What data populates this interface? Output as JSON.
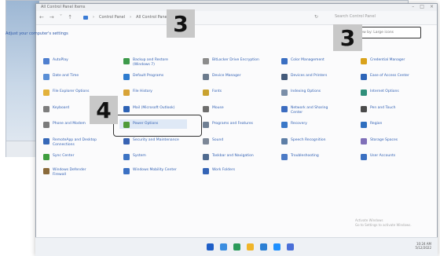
{
  "window": {
    "title": "All Control Panel Items",
    "subtitle": "Adjust your computer's settings",
    "view_by": "View by: Large icons"
  },
  "address": {
    "path": [
      "Control Panel",
      "All Control Panel Items"
    ],
    "search_placeholder": "Search Control Panel"
  },
  "callouts": [
    "3",
    "3",
    "4"
  ],
  "items": [
    {
      "label": "AutoPlay",
      "color": "#4f7fcf"
    },
    {
      "label": "Backup and Restore (Windows 7)",
      "color": "#3d9a4b"
    },
    {
      "label": "BitLocker Drive Encryption",
      "color": "#8c8c8c"
    },
    {
      "label": "Color Management",
      "color": "#3b6fc2"
    },
    {
      "label": "Credential Manager",
      "color": "#d9a21b"
    },
    {
      "label": "Date and Time",
      "color": "#5a8fd6"
    },
    {
      "label": "Default Programs",
      "color": "#2e7bcf"
    },
    {
      "label": "Device Manager",
      "color": "#6b7a8c"
    },
    {
      "label": "Devices and Printers",
      "color": "#445a7a"
    },
    {
      "label": "Ease of Access Center",
      "color": "#2c64b8"
    },
    {
      "label": "File Explorer Options",
      "color": "#e3b23c"
    },
    {
      "label": "File History",
      "color": "#d8a337"
    },
    {
      "label": "Fonts",
      "color": "#c9a22f"
    },
    {
      "label": "Indexing Options",
      "color": "#7a8ea8"
    },
    {
      "label": "Internet Options",
      "color": "#2f8f7a"
    },
    {
      "label": "Keyboard",
      "color": "#7d7d7d"
    },
    {
      "label": "Mail (Microsoft Outlook)",
      "color": "#2d62b5"
    },
    {
      "label": "Mouse",
      "color": "#6d6d6d"
    },
    {
      "label": "Network and Sharing Center",
      "color": "#3c6cc0"
    },
    {
      "label": "Pen and Touch",
      "color": "#4a4a4a"
    },
    {
      "label": "Phone and Modem",
      "color": "#7b7b7b"
    },
    {
      "label": "Power Options",
      "color": "#4f9b3a"
    },
    {
      "label": "Programs and Features",
      "color": "#6f7f93"
    },
    {
      "label": "Recovery",
      "color": "#3a78c8"
    },
    {
      "label": "Region",
      "color": "#2f6fbf"
    },
    {
      "label": "RemoteApp and Desktop Connections",
      "color": "#3668b8"
    },
    {
      "label": "Security and Maintenance",
      "color": "#3863b3"
    },
    {
      "label": "Sound",
      "color": "#7c8797"
    },
    {
      "label": "Speech Recognition",
      "color": "#5d7ea6"
    },
    {
      "label": "Storage Spaces",
      "color": "#7f6fb8"
    },
    {
      "label": "Sync Center",
      "color": "#3f9e3f"
    },
    {
      "label": "System",
      "color": "#3d74c4"
    },
    {
      "label": "Taskbar and Navigation",
      "color": "#4f6a8f"
    },
    {
      "label": "Troubleshooting",
      "color": "#4b7ac5"
    },
    {
      "label": "User Accounts",
      "color": "#3a6fc1"
    },
    {
      "label": "Windows Defender Firewall",
      "color": "#8a6a3a"
    },
    {
      "label": "Windows Mobility Center",
      "color": "#3b70c3"
    },
    {
      "label": "Work Folders",
      "color": "#3464b6"
    }
  ],
  "activation": {
    "line1": "Activate Windows",
    "line2": "Go to Settings to activate Windows."
  },
  "taskbar": {
    "icon_colors": [
      "#1f5fc8",
      "#3a8de0",
      "#2b9a5a",
      "#f0b52a",
      "#2b7fd4",
      "#1e90ff",
      "#4a6fd8"
    ],
    "time": "10:24 AM",
    "date": "5/12/2022"
  }
}
